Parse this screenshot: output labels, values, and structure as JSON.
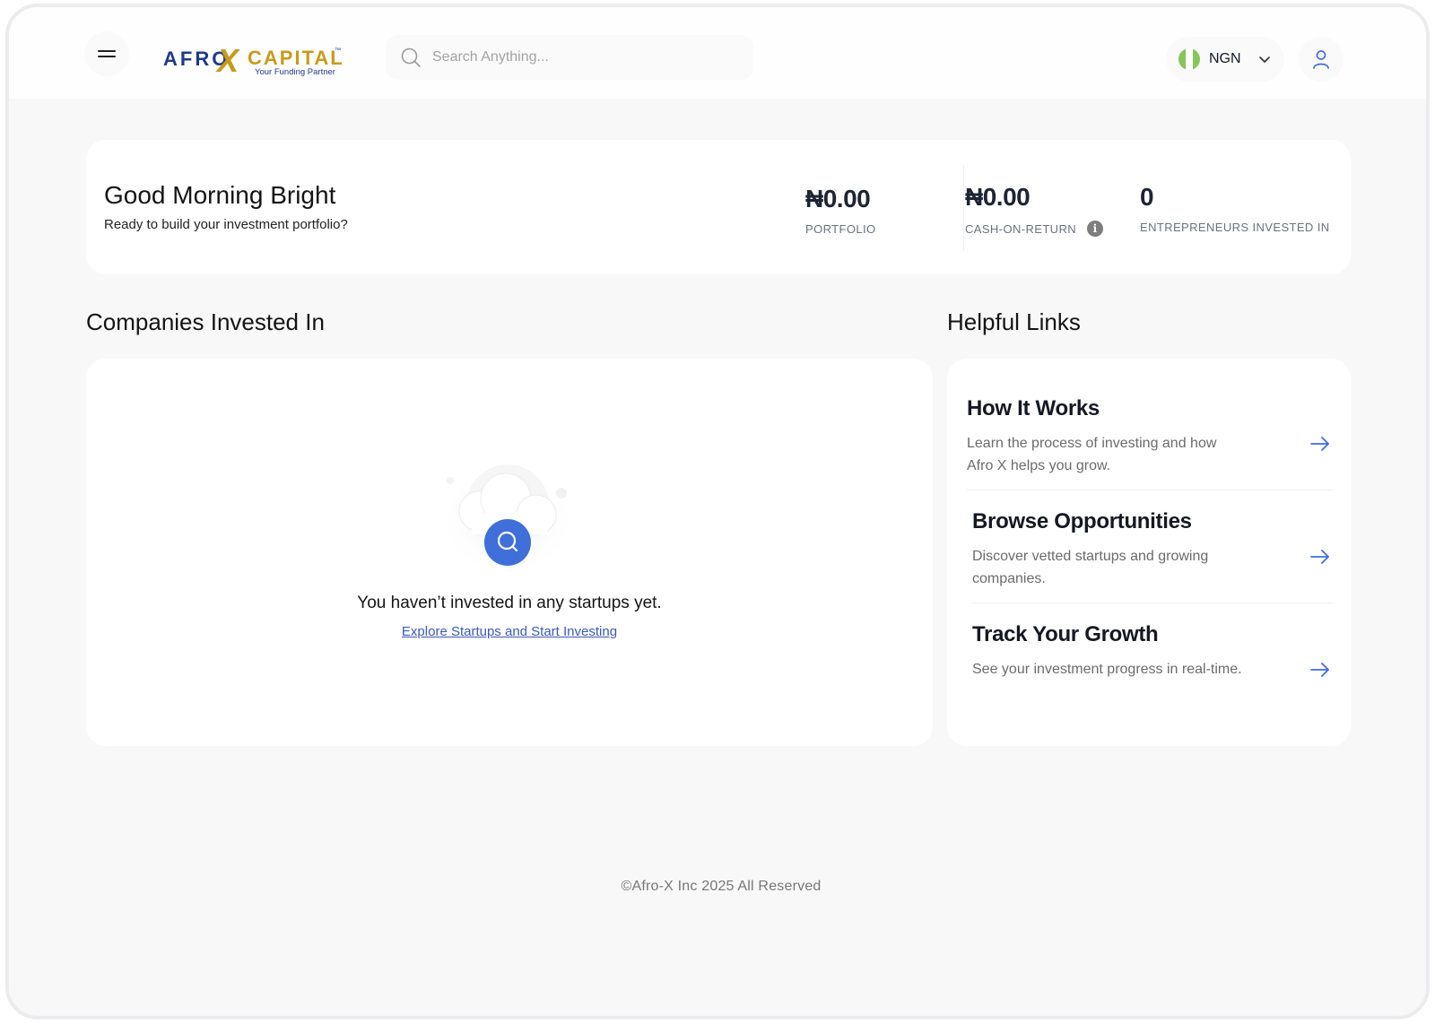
{
  "header": {
    "logo_main": "AFRO",
    "logo_x": "X",
    "logo_capital": "CAPITAL",
    "logo_tm": "™",
    "logo_tagline": "Your Funding Partner",
    "search_placeholder": "Search Anything...",
    "currency_code": "NGN"
  },
  "summary": {
    "greeting": "Good Morning Bright",
    "subtitle": "Ready to build your investment portfolio?",
    "stats": [
      {
        "value": "₦0.00",
        "label": "PORTFOLIO"
      },
      {
        "value": "₦0.00",
        "label": "CASH-ON-RETURN"
      },
      {
        "value": "0",
        "label": "ENTREPRENEURS INVESTED IN"
      }
    ],
    "info_glyph": "i"
  },
  "companies": {
    "title": "Companies Invested In",
    "empty_text": "You haven’t invested in any startups yet.",
    "empty_link": "Explore Startups and Start Investing"
  },
  "helpful_links": {
    "title": "Helpful Links",
    "items": [
      {
        "title": "How It Works",
        "desc": "Learn the process of investing and how Afro X helps you grow."
      },
      {
        "title": "Browse Opportunities",
        "desc": "Discover vetted startups and growing companies."
      },
      {
        "title": "Track Your Growth",
        "desc": "See your investment progress in real-time."
      }
    ]
  },
  "footer": {
    "text": "©Afro-X Inc 2025 All Reserved"
  },
  "colors": {
    "brand_blue": "#1e3a8a",
    "brand_gold": "#c99a1a",
    "accent_blue": "#3f6fd8",
    "link_blue": "#3b5bb6",
    "flag_green": "#86c65a"
  }
}
